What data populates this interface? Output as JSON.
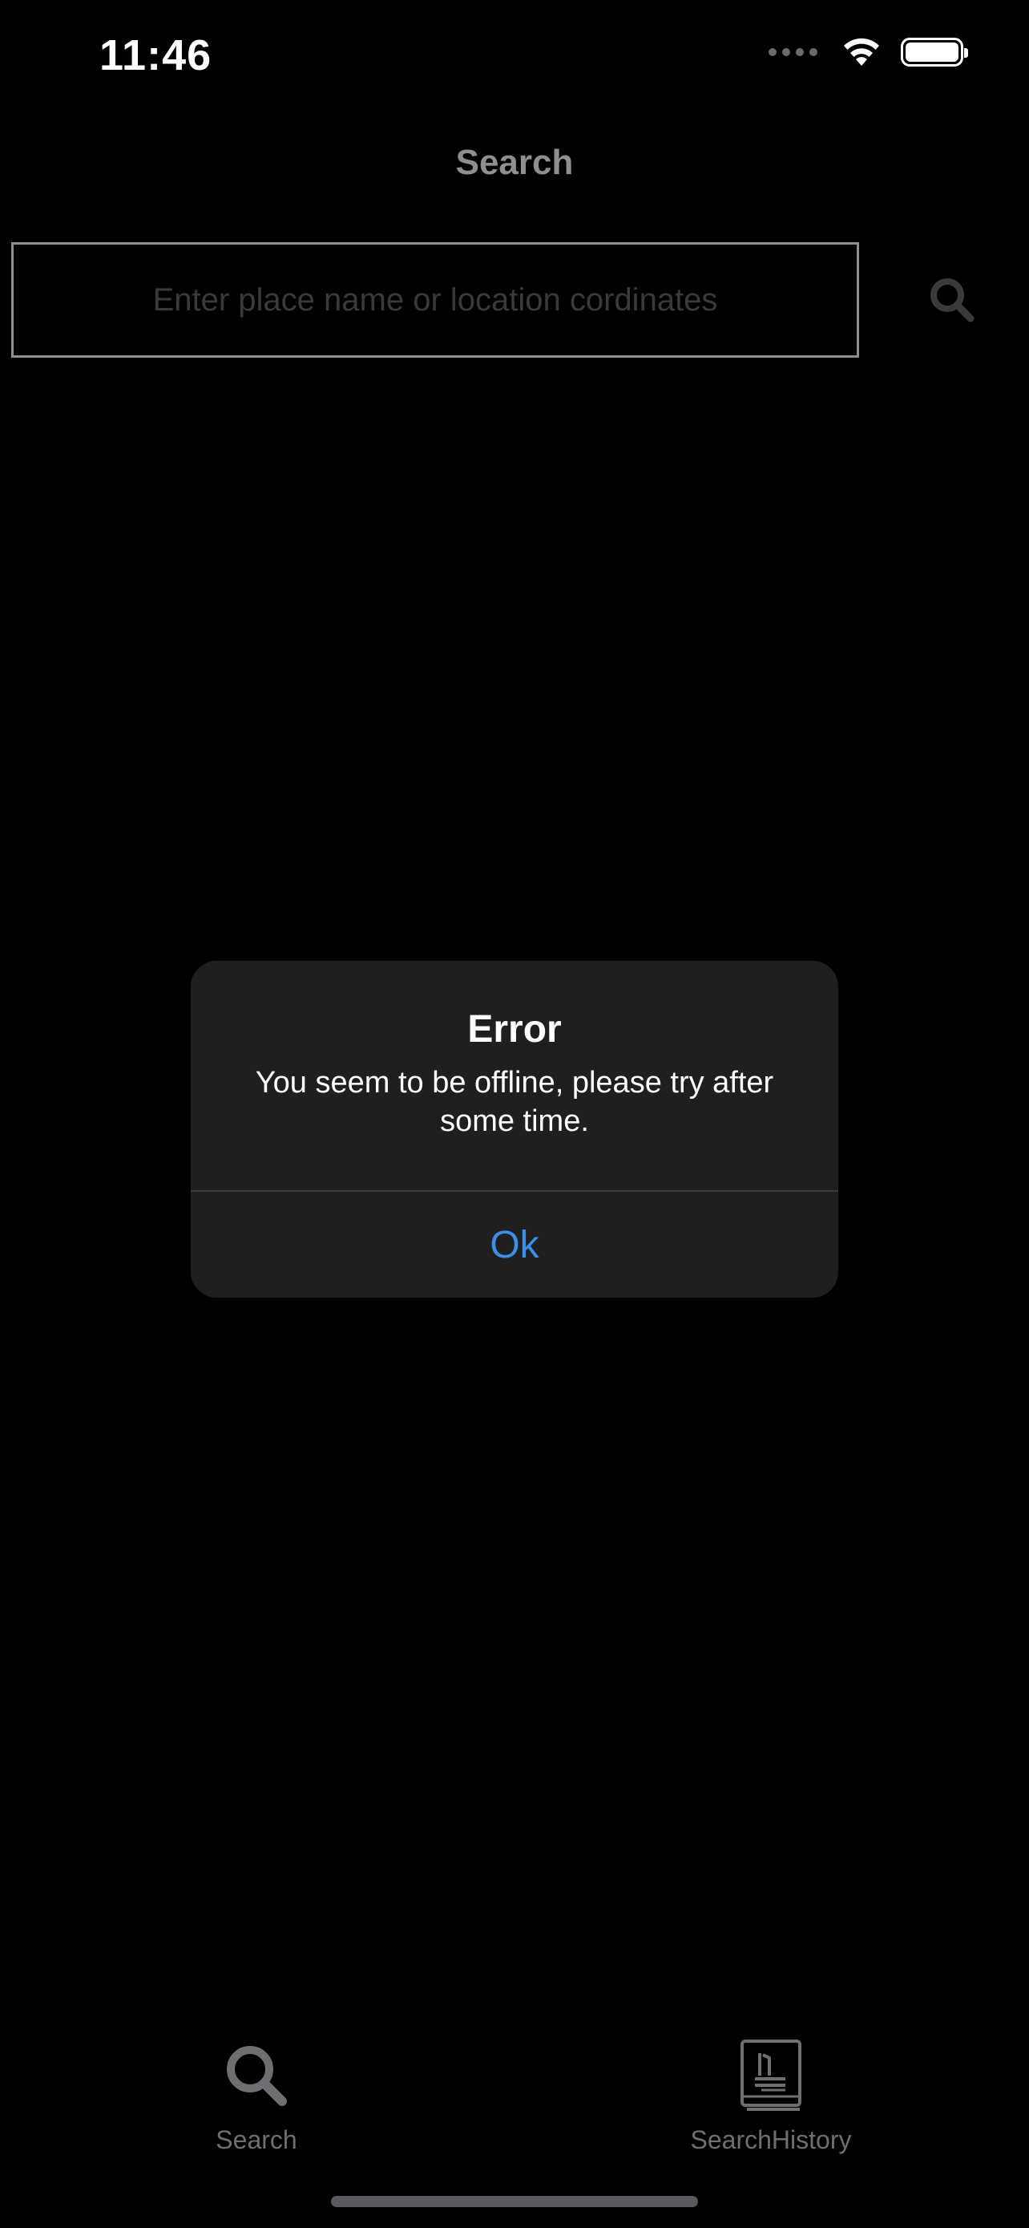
{
  "status_bar": {
    "time": "11:46",
    "icons": [
      "cellular-signal-icon",
      "wifi-icon",
      "battery-icon"
    ]
  },
  "nav": {
    "title": "Search"
  },
  "search": {
    "placeholder": "Enter place name or location cordinates",
    "value": "",
    "button_icon": "search-icon"
  },
  "alert": {
    "title": "Error",
    "message": "You seem to be offline, please try after some time.",
    "button_label": "Ok"
  },
  "tab_bar": {
    "tabs": [
      {
        "label": "Search",
        "icon": "search-icon"
      },
      {
        "label": "SearchHistory",
        "icon": "book-icon"
      }
    ]
  },
  "colors": {
    "background": "#000000",
    "alert_background": "#1f1f1f",
    "accent": "#3e8ee8",
    "muted": "#8e8e93",
    "tab_inactive": "#6e6e73"
  }
}
